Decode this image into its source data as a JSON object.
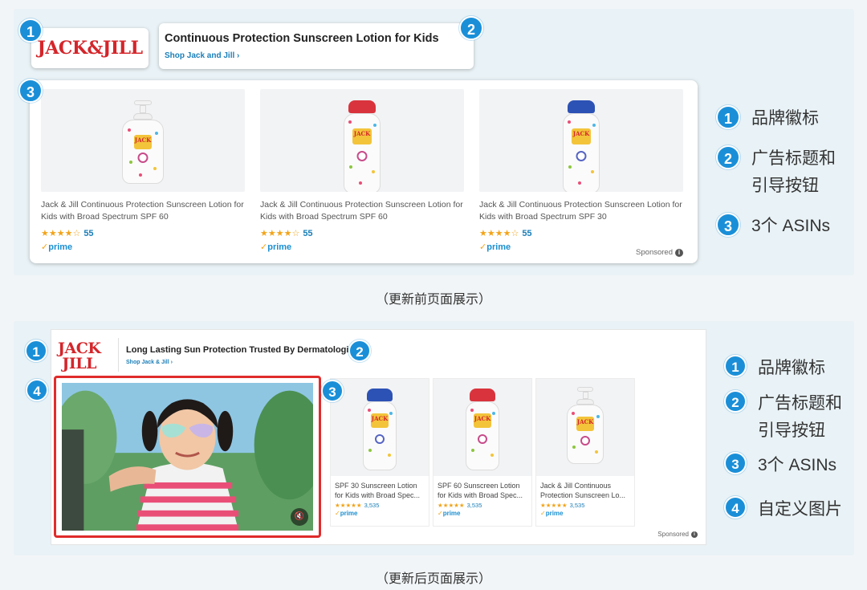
{
  "colors": {
    "badge": "#1a8fd8",
    "brand_red": "#d4262b",
    "highlight": "#e02b2b",
    "link": "#1b7fb8",
    "star": "#f2a41a"
  },
  "before": {
    "brand_logo": "JACK&JILL",
    "headline": "Continuous Protection Sunscreen Lotion for Kids",
    "shop_link": "Shop Jack and Jill ›",
    "products": [
      {
        "name": "Jack & Jill Continuous Protection Sunscreen Lotion for Kids with Broad Spectrum SPF 60",
        "stars": "★★★★☆",
        "rating_count": "55",
        "prime": "prime",
        "cap_color": "#f0f0f0",
        "type": "pump"
      },
      {
        "name": "Jack & Jill Continuous Protection Sunscreen Lotion for Kids with Broad Spectrum SPF 60",
        "stars": "★★★★☆",
        "rating_count": "55",
        "prime": "prime",
        "cap_color": "#d9333d",
        "type": "tube"
      },
      {
        "name": "Jack & Jill Continuous Protection Sunscreen Lotion for Kids with Broad Spectrum SPF 30",
        "stars": "★★★★☆",
        "rating_count": "55",
        "prime": "prime",
        "cap_color": "#2d52b5",
        "type": "tube"
      }
    ],
    "sponsored": "Sponsored",
    "caption": "（更新前页面展示）"
  },
  "after": {
    "brand_logo_line1": "JACK",
    "brand_logo_line2": "JILL",
    "headline": "Long Lasting Sun Protection Trusted By Dermatologists",
    "shop_link": "Shop Jack & Jill ›",
    "products": [
      {
        "name": "SPF 30 Sunscreen Lotion for Kids with Broad Spec...",
        "stars": "★★★★★",
        "rating_count": "3,535",
        "prime": "prime",
        "cap_color": "#2d52b5",
        "type": "tube"
      },
      {
        "name": "SPF 60 Sunscreen Lotion for Kids with Broad Spec...",
        "stars": "★★★★★",
        "rating_count": "3,535",
        "prime": "prime",
        "cap_color": "#d9333d",
        "type": "tube"
      },
      {
        "name": "Jack & Jill Continuous Protection Sunscreen Lo...",
        "stars": "★★★★★",
        "rating_count": "3,535",
        "prime": "prime",
        "cap_color": "#f0f0f0",
        "type": "pump"
      }
    ],
    "sponsored": "Sponsored",
    "caption": "（更新后页面展示）"
  },
  "markers": {
    "m1": "1",
    "m2": "2",
    "m3": "3",
    "m4": "4"
  },
  "legend_before": [
    {
      "num": "1",
      "text": "品牌徽标"
    },
    {
      "num": "2",
      "text": "广告标题和",
      "text2": "引导按钮"
    },
    {
      "num": "3",
      "text": "3个 ASINs"
    }
  ],
  "legend_after": [
    {
      "num": "1",
      "text": "品牌徽标"
    },
    {
      "num": "2",
      "text": "广告标题和",
      "text2": "引导按钮"
    },
    {
      "num": "3",
      "text": "3个 ASINs"
    },
    {
      "num": "4",
      "text": "自定义图片"
    }
  ]
}
